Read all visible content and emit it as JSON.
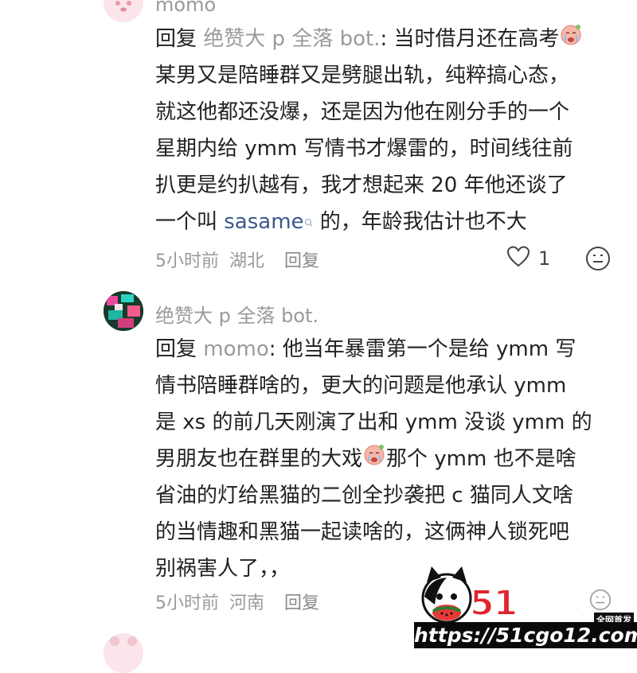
{
  "comment1": {
    "username": "momo",
    "reply_prefix": "回复",
    "reply_to": "绝赞大 p 全落 bot.",
    "lines": [
      ": 当时借月还在高考",
      "某男又是陪睡群又是劈腿出轨，纯粹搞心态，",
      "就这他都还没爆，还是因为他在刚分手的一个",
      "星期内给 ymm 写情书才爆雷的，时间线往前",
      "扒更是约扒越有，我才想起来 20 年他还谈了"
    ],
    "last_line_pre": "一个叫 ",
    "last_line_link": "sasame",
    "last_line_post": " 的，年龄我估计也不大",
    "time": "5小时前",
    "location": "湖北",
    "reply_label": "回复",
    "likes": "1"
  },
  "comment2": {
    "username": "绝赞大 p 全落 bot.",
    "reply_prefix": "回复",
    "reply_to": "momo",
    "line1": ": 他当年暴雷第一个是给 ymm 写",
    "line2": "情书陪睡群啥的，更大的问题是他承认 ymm",
    "line3": "是 xs 的前几天刚演了出和 ymm 没谈 ymm 的",
    "line4_pre": "男朋友也在群里的大戏",
    "line4_post": "那个 ymm 也不是啥",
    "line5": "省油的灯给黑猫的二创全抄袭把 c 猫同人文啥",
    "line6": "的当情趣和黑猫一起读啥的，这俩神人锁死吧",
    "line7": "别祸害人了，，",
    "time": "5小时前",
    "location": "河南",
    "reply_label": "回复"
  },
  "watermark": {
    "logo_text": "51吃瓜",
    "badge_text": "全网首发",
    "url": "https://51cgo12.com"
  },
  "icons": [
    "heart-icon",
    "smile-icon",
    "search-icon",
    "crying-emoji-icon"
  ]
}
